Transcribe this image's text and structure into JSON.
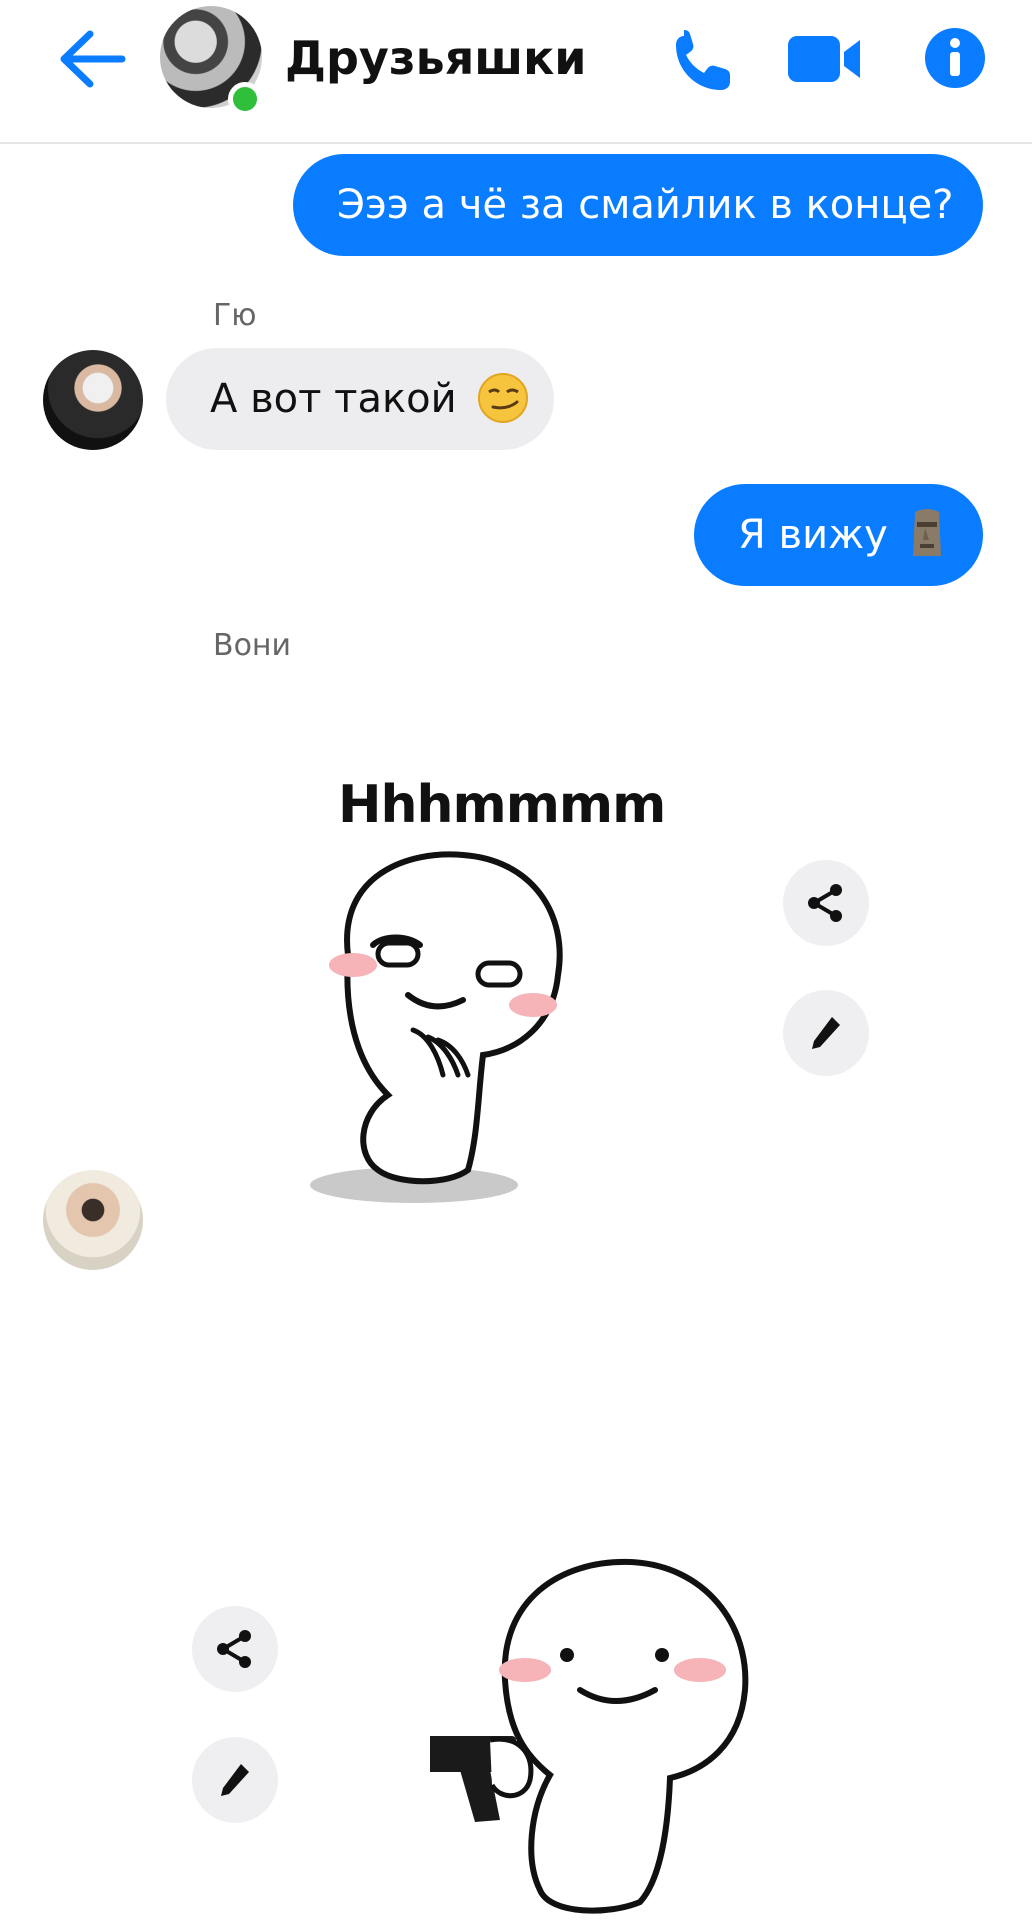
{
  "header": {
    "title": "Друзьяшки",
    "online": true,
    "icons": [
      "back-arrow-icon",
      "phone-icon",
      "video-camera-icon",
      "info-icon"
    ],
    "accent": "#0a7cff"
  },
  "messages": [
    {
      "from": "me",
      "text": "Эээ а чё за смайлик в конце?"
    },
    {
      "from": "Гю",
      "sender_label": "Гю",
      "text": "А вот такой",
      "emoji": "smirking-face-emoji"
    },
    {
      "from": "me",
      "text": "Я вижу",
      "emoji": "moai-emoji"
    },
    {
      "from": "Вони",
      "sender_label": "Вони",
      "sticker": "sticker-hmm",
      "sticker_text": "Hhhmmmm"
    },
    {
      "from": "me",
      "sticker": "sticker-gun"
    }
  ],
  "colors": {
    "outgoing": "#0a7cff",
    "incoming": "#ededf0",
    "online": "#2fbf3a"
  }
}
